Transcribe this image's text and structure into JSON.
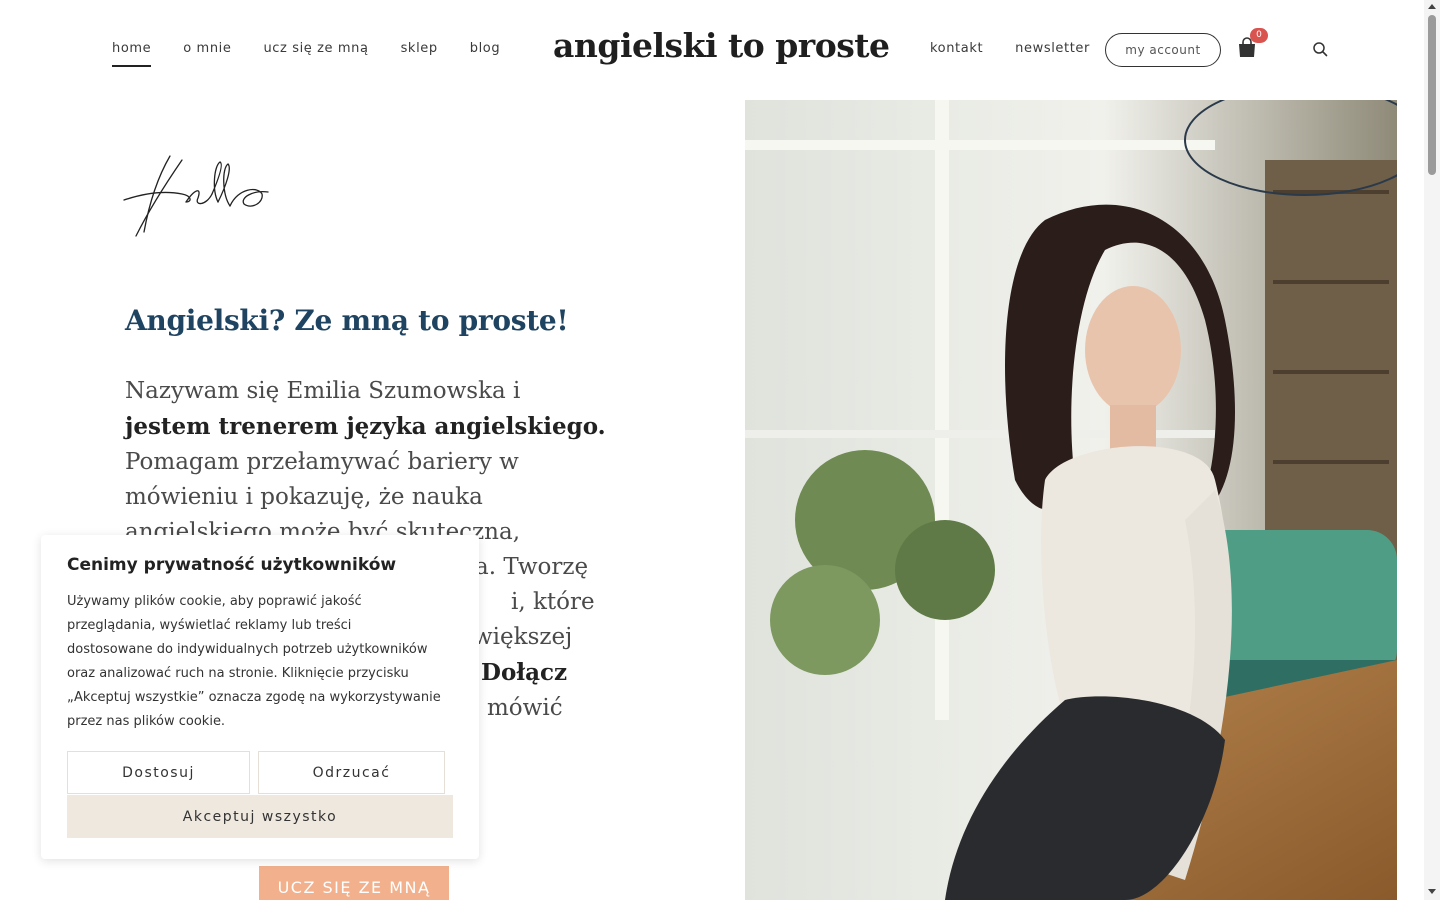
{
  "header": {
    "brand": "angielski to proste",
    "nav_left": [
      {
        "label": "home",
        "active": true
      },
      {
        "label": "o mnie",
        "active": false
      },
      {
        "label": "ucz się ze mną",
        "active": false
      },
      {
        "label": "sklep",
        "active": false
      },
      {
        "label": "blog",
        "active": false
      }
    ],
    "nav_right": [
      {
        "label": "kontakt"
      },
      {
        "label": "newsletter"
      }
    ],
    "account_label": "my account",
    "cart_count": "0",
    "cart_icon": "shopping-bag-icon",
    "search_icon": "search-icon"
  },
  "hero": {
    "script_greeting": "Hello",
    "heading": "Angielski? Ze mną to proste!",
    "text_lines": [
      [
        {
          "t": "Nazywam się Emilia Szumowska i",
          "b": false
        }
      ],
      [
        {
          "t": "jestem trenerem języka angielskiego.",
          "b": true
        }
      ],
      [
        {
          "t": "Pomagam przełamywać bariery w",
          "b": false
        }
      ],
      [
        {
          "t": "mówieniu i pokazuję, że nauka",
          "b": false
        }
      ],
      [
        {
          "t": "angielskiego może być skuteczna,",
          "b": false
        }
      ],
      [
        {
          "t": "",
          "b": false
        },
        {
          "t": "a. Tworzę",
          "b": false
        }
      ],
      [
        {
          "t": "",
          "b": false
        },
        {
          "t": "i, które",
          "b": false
        }
      ],
      [
        {
          "t": "",
          "b": false
        },
        {
          "t": "większej",
          "b": false
        }
      ],
      [
        {
          "t": "",
          "b": false
        },
        {
          "t": "Dołącz",
          "b": true
        }
      ],
      [
        {
          "t": "",
          "b": false
        },
        {
          "t": "mówić",
          "b": false
        }
      ]
    ],
    "cta_label": "UCZ SIĘ ZE MNĄ",
    "colors": {
      "heading": "#1f4462",
      "cta": "#f2b08c"
    }
  },
  "cookie": {
    "title": "Cenimy prywatność użytkowników",
    "text_lines": [
      "Używamy plików cookie, aby poprawić jakość",
      "przeglądania, wyświetlać reklamy lub treści",
      "dostosowane do indywidualnych potrzeb użytkowników",
      "oraz analizować ruch na stronie. Kliknięcie przycisku",
      "„Akceptuj wszystkie” oznacza zgodę na wykorzystywanie",
      "przez nas plików cookie."
    ],
    "customize_label": "Dostosuj",
    "reject_label": "Odrzucać",
    "accept_label": "Akceptuj wszystko"
  }
}
